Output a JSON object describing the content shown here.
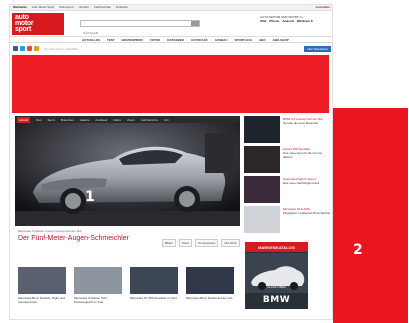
{
  "topnav": {
    "items": [
      "Startseite",
      "Auto Motor Sport",
      "Motorsport",
      "Verkehr",
      "Fahrberichte",
      "Rubriken"
    ],
    "login": "Anmelden"
  },
  "header": {
    "logo": [
      "auto",
      "motor",
      "sport"
    ],
    "search_placeholder": "Suchbegriff",
    "promo_label": "AUTO MOTOR UND SPORT im:",
    "promo_links": [
      "iPad",
      "iPhone",
      "Android",
      "Windows 8"
    ]
  },
  "mainnav": [
    "AKTUELLES",
    "TEST",
    "BESTENPROFI",
    "FOTOS",
    "RATGEBER",
    "AUTOKAUF",
    "AUSBAU",
    "SPORTLICH",
    "ABO",
    "ABO-SHOP"
  ],
  "social": {
    "text": "Top-Themen im Überblick",
    "newsletter": "Hier Newsletter"
  },
  "colors": {
    "brand_red": "#d71920",
    "ad_red": "#ee1c25",
    "facebook": "#3b5998",
    "twitter": "#1da1f2",
    "google": "#dd4b39",
    "newsletter_blue": "#2d6db5"
  },
  "hero": {
    "tabs": [
      "Aktuell",
      "Test",
      "Sport",
      "Brandneu",
      "Galerie",
      "Autokauf",
      "Markt",
      "Vision",
      "Fahrberichte",
      "4x4"
    ],
    "overlay_number": "1",
    "caption_label": "Mercedes S-Klasse Coupé Concept auf der IAA",
    "title": "Der Fünf-Meter-Augen-Schmeichler",
    "meta_buttons": [
      "Bilder",
      "Video",
      "Kommentare",
      "IAA 2013"
    ]
  },
  "thumbs": [
    {
      "title": "Mercedes-Benz Modelle, Night und Aerodynamics",
      "color": "#5a6070"
    },
    {
      "title": "Mercedes S-Klasse SUV, Preisvergleich im Test",
      "color": "#8d95a0"
    },
    {
      "title": "Mercedes SL 500 Roadster im Test",
      "color": "#3d4654"
    },
    {
      "title": "Mercedes-Benz Modell auf der IAA",
      "color": "#30384a"
    }
  ],
  "sidebar": [
    {
      "title": "BMW X4 Concept auf der IAA",
      "subtitle": "So teile die neue Baureihe",
      "color": "#1e242c"
    },
    {
      "title": "Ferrari 458 Speciale",
      "subtitle": "Das neue Auto für die Formel Italiens",
      "color": "#2c2626"
    },
    {
      "title": "Opel Astra Sports Tourer",
      "subtitle": "Das neue Nachfolgemodell",
      "color": "#3a2a3a"
    },
    {
      "title": "Mercedes SLS AMG",
      "subtitle": "Flügeltürer im Electric-Drive-Modus",
      "color": "#cfd3d8"
    }
  ],
  "brand_ad": {
    "header": "MARKENKATALOG",
    "sub": "ALLES ÜBER",
    "brand": "BMW"
  },
  "ad_overlay": {
    "number": "2"
  }
}
